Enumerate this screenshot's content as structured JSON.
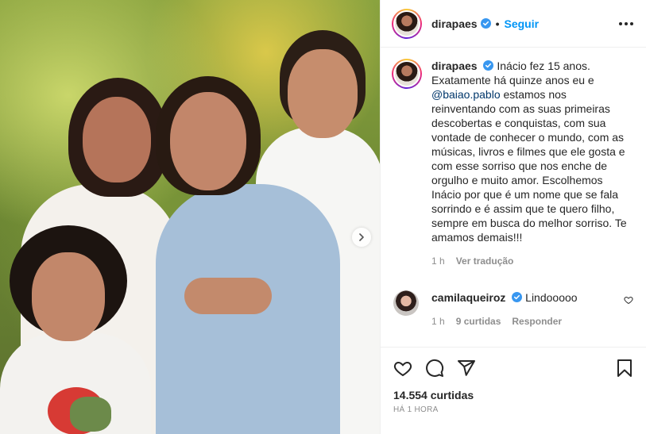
{
  "post": {
    "author": "dirapaes",
    "follow_label": "Seguir",
    "separator": "•",
    "icons": {
      "verified": "verified-badge-icon",
      "more": "more-options-icon",
      "carousel_next": "chevron-right-icon",
      "like": "heart-icon",
      "comment": "comment-icon",
      "share": "share-icon",
      "save": "bookmark-icon"
    },
    "colors": {
      "link": "#0095f6",
      "mention": "#00376b",
      "muted": "#8e8e8e"
    }
  },
  "caption": {
    "username": "dirapaes",
    "text_before_mention": "Inácio fez 15 anos. Exatamente há quinze anos eu e",
    "mention": "@baiao.pablo",
    "text_after_mention": "estamos nos reinventando com as suas primeiras descobertas e conquistas, com sua vontade de conhecer o mundo, com as músicas, livros e filmes que ele gosta e com esse sorriso que nos enche de orgulho e muito amor. Escolhemos Inácio por que é um nome que se fala sorrindo e é assim que te quero filho, sempre em busca do melhor sorriso. Te amamos demais!!!",
    "time": "1 h",
    "translate_label": "Ver tradução"
  },
  "comment": {
    "username": "camilaqueiroz",
    "text": "Lindooooo",
    "time": "1 h",
    "likes_label": "9 curtidas",
    "reply_label": "Responder"
  },
  "footer": {
    "likes": "14.554 curtidas",
    "posted": "HÁ 1 HORA"
  }
}
